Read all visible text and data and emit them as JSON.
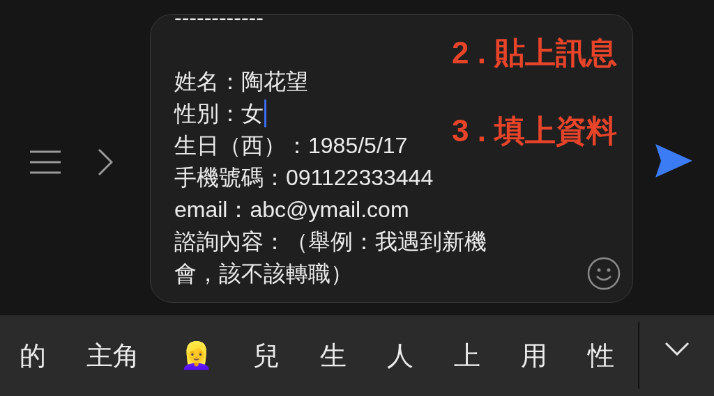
{
  "message_field": {
    "lines": [
      {
        "kind": "text",
        "text": "------------",
        "cursor": false
      },
      {
        "kind": "blank"
      },
      {
        "kind": "text",
        "text": "姓名：陶花望",
        "cursor": false
      },
      {
        "kind": "text",
        "text": "性別：女",
        "cursor": true
      },
      {
        "kind": "text",
        "text": "生日（西）：1985/5/17",
        "cursor": false
      },
      {
        "kind": "text",
        "text": "手機號碼：091122333444",
        "cursor": false
      },
      {
        "kind": "text",
        "text": "email：abc@ymail.com",
        "cursor": false
      },
      {
        "kind": "text",
        "text": "諮詢內容：（舉例：我遇到新機",
        "cursor": false
      },
      {
        "kind": "text",
        "text": "會，該不該轉職）",
        "cursor": false
      }
    ]
  },
  "annotations": [
    "2 . 貼上訊息",
    "3 . 填上資料"
  ],
  "suggestions": [
    "的",
    "主角",
    "👱‍♀️",
    "兒",
    "生",
    "人",
    "上",
    "用",
    "性"
  ]
}
